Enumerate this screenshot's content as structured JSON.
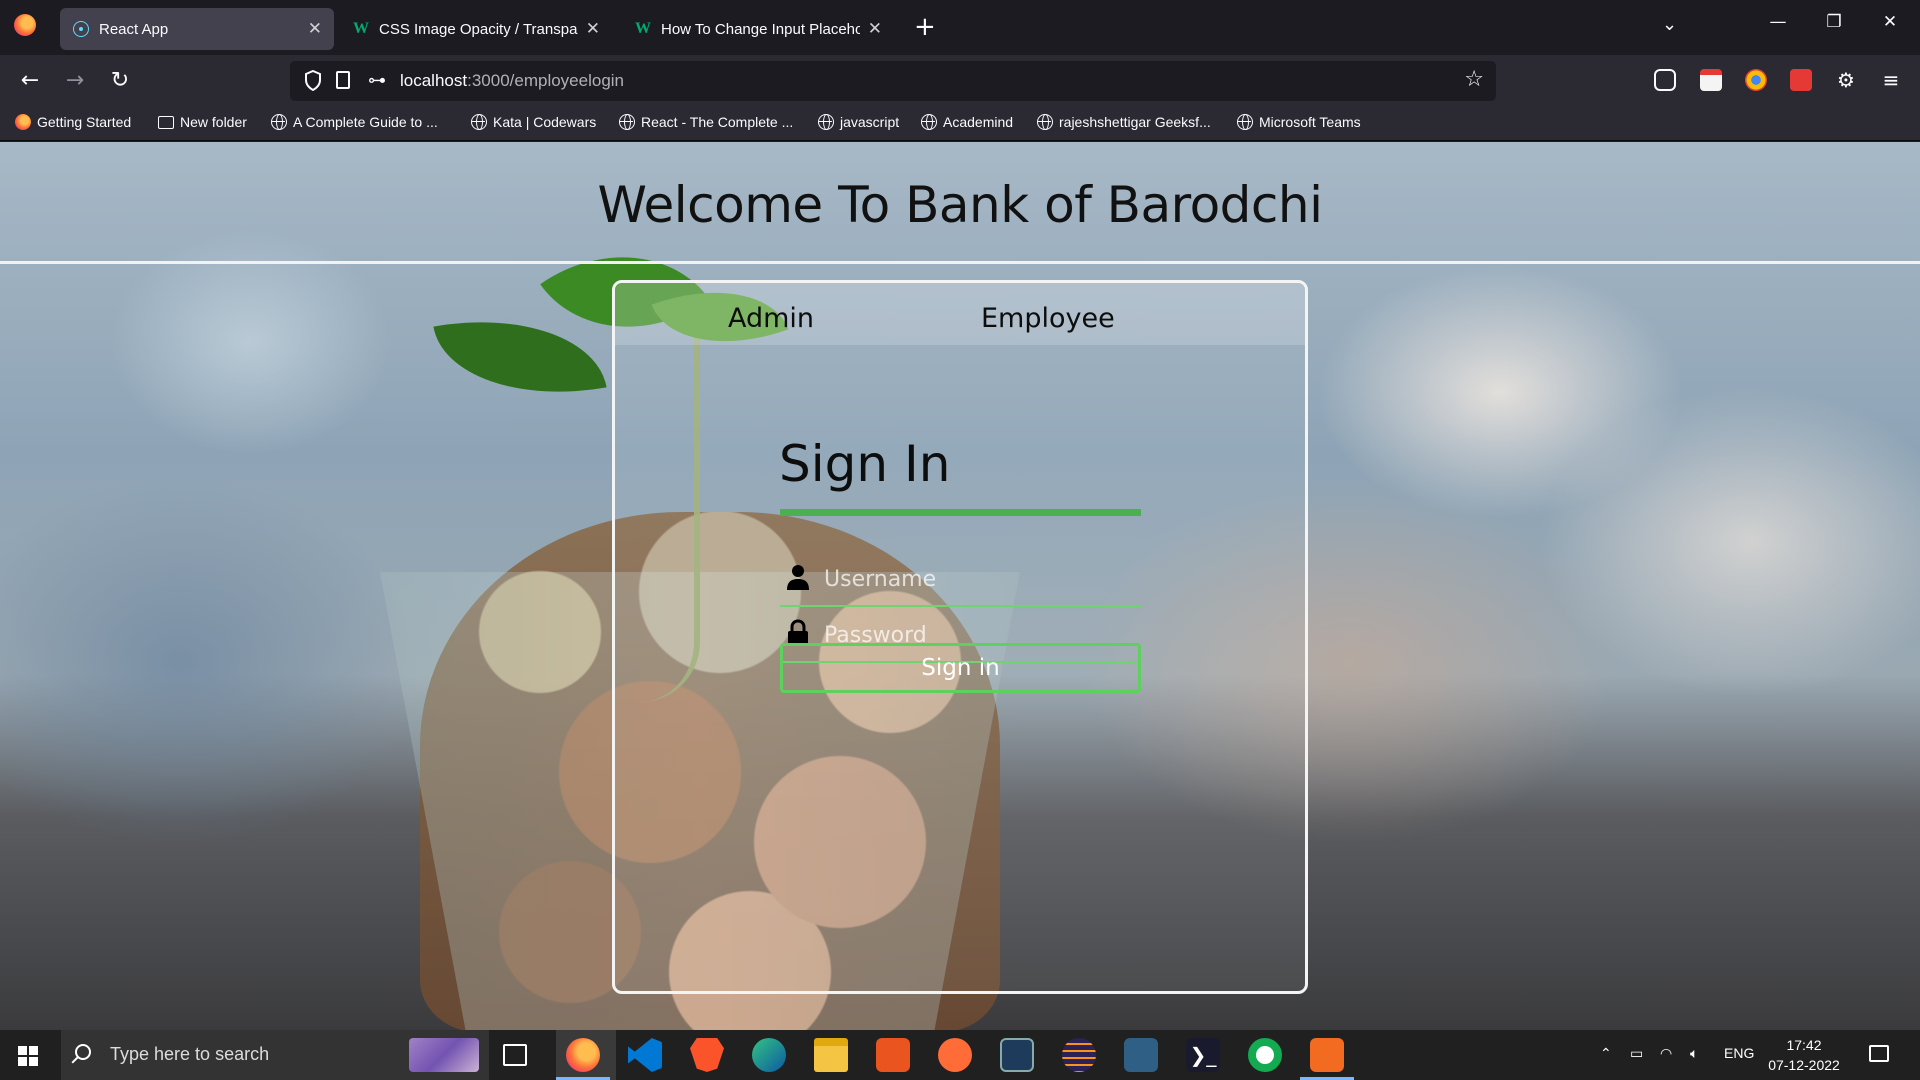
{
  "browser": {
    "tabs": [
      {
        "title": "React App",
        "active": true,
        "icon": "react-icon"
      },
      {
        "title": "CSS Image Opacity / Transparency",
        "active": false,
        "icon": "w3schools-icon"
      },
      {
        "title": "How To Change Input Placeholder Color",
        "active": false,
        "icon": "w3schools-icon"
      }
    ],
    "url_host": "localhost",
    "url_path": ":3000/employeelogin",
    "bookmarks": [
      {
        "label": "Getting Started",
        "icon": "firefox-icon"
      },
      {
        "label": "New folder",
        "icon": "folder-icon"
      },
      {
        "label": "A Complete Guide to ...",
        "icon": "globe-icon"
      },
      {
        "label": "Kata | Codewars",
        "icon": "globe-icon"
      },
      {
        "label": "React - The Complete ...",
        "icon": "globe-icon"
      },
      {
        "label": "javascript",
        "icon": "globe-icon"
      },
      {
        "label": "Academind",
        "icon": "globe-icon"
      },
      {
        "label": "rajeshshettigar Geeksf...",
        "icon": "globe-icon"
      },
      {
        "label": "Microsoft Teams",
        "icon": "globe-icon"
      }
    ]
  },
  "app": {
    "heading": "Welcome To Bank of Barodchi",
    "tabs": {
      "admin": "Admin",
      "employee": "Employee"
    },
    "form": {
      "title": "Sign In",
      "username_placeholder": "Username",
      "password_placeholder": "Password",
      "submit_label": "Sign in"
    },
    "accent_color": "#4caf50"
  },
  "taskbar": {
    "search_placeholder": "Type here to search",
    "language": "ENG",
    "time": "17:42",
    "date": "07-12-2022"
  }
}
